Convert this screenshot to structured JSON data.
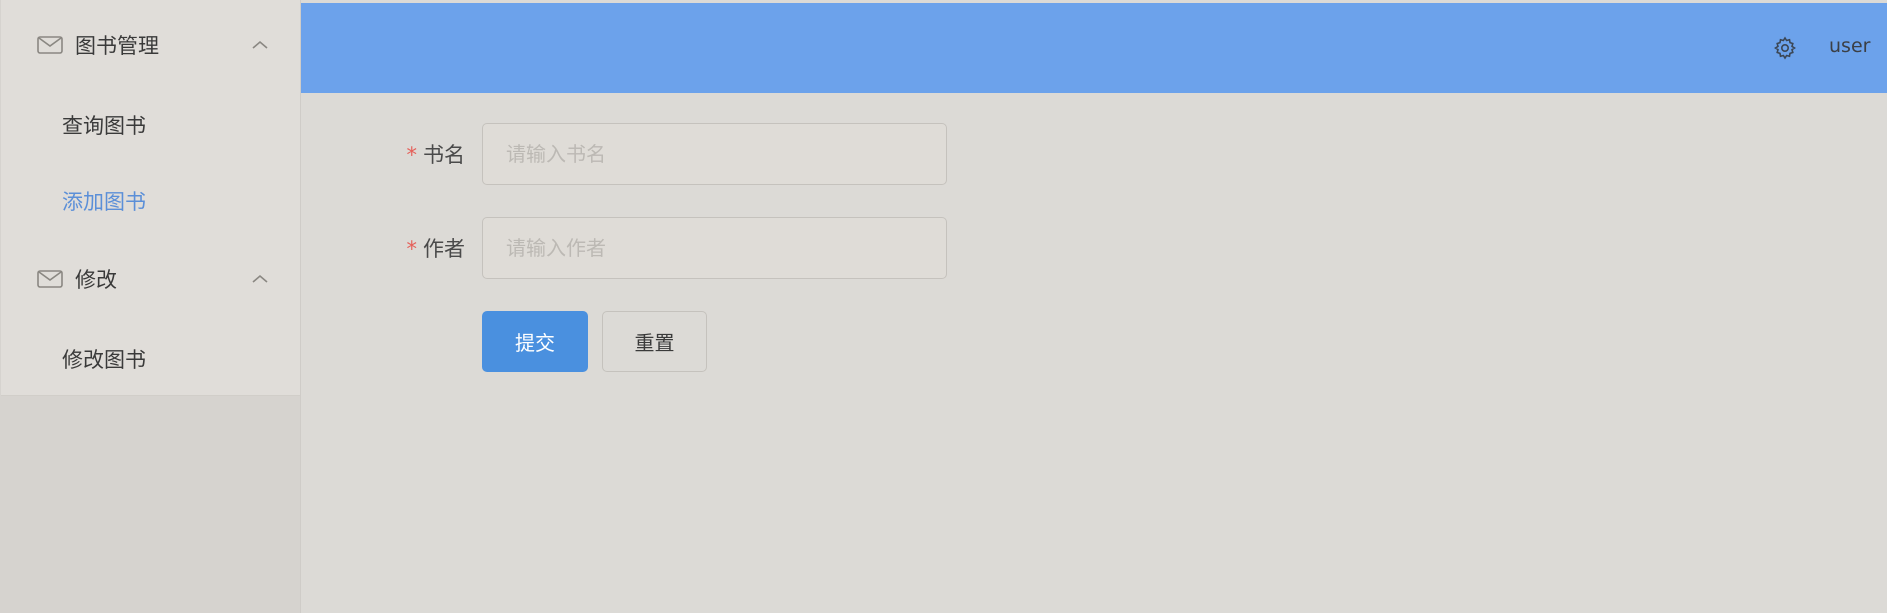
{
  "sidebar": {
    "groups": [
      {
        "title": "图书管理",
        "icon": "mail-icon",
        "items": [
          {
            "label": "查询图书",
            "active": false
          },
          {
            "label": "添加图书",
            "active": true
          }
        ]
      },
      {
        "title": "修改",
        "icon": "mail-icon",
        "items": [
          {
            "label": "修改图书",
            "active": false
          }
        ]
      }
    ]
  },
  "header": {
    "settings_icon": "gear-icon",
    "username": "user"
  },
  "form": {
    "fields": [
      {
        "label": "书名",
        "required": true,
        "value": "",
        "placeholder": "请输入书名"
      },
      {
        "label": "作者",
        "required": true,
        "value": "",
        "placeholder": "请输入作者"
      }
    ],
    "required_mark": "*",
    "submit_label": "提交",
    "reset_label": "重置"
  },
  "colors": {
    "header_bg": "#6ca2eb",
    "active_menu": "#5b8fd8",
    "primary_button": "#4a90df",
    "required_mark": "#e5605a"
  }
}
